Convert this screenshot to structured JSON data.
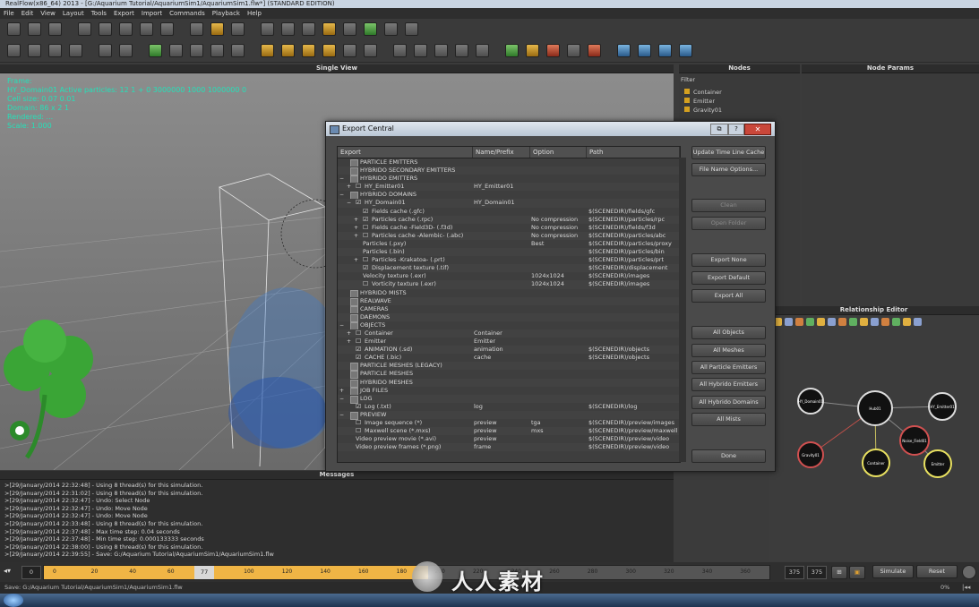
{
  "window": {
    "title": "RealFlow(x86_64) 2013 - [G:/Aquarium Tutorial/AquariumSim1/AquariumSim1.flw*] (STANDARD EDITION)"
  },
  "menu": [
    "File",
    "Edit",
    "View",
    "Layout",
    "Tools",
    "Export",
    "Import",
    "Commands",
    "Playback",
    "Help"
  ],
  "viewport": {
    "title": "Single View",
    "hud": [
      "Frame:",
      "HY_Domain01  Active particles: 12 1 + 0 3000000 1000 1000000 0",
      "Cell size:  0.07  0.01",
      "Domain: 86 x 2 1",
      "Rendered: ...",
      "Scale: 1.000"
    ]
  },
  "nodes": {
    "title": "Nodes",
    "filter": "Filter",
    "items": [
      "Container",
      "Emitter",
      "Gravity01"
    ]
  },
  "params": {
    "title": "Node Params"
  },
  "relationship": {
    "title": "Relationship Editor",
    "nodes": [
      "HY_Domain01",
      "Hub01",
      "HY_Emitter01",
      "Gravity01",
      "Container",
      "Noise_Field01",
      "Emitter"
    ]
  },
  "dialog": {
    "title": "Export Central",
    "columns": [
      "Export",
      "Name/Prefix",
      "Option",
      "Path"
    ],
    "rows": [
      {
        "indent": 0,
        "exp": "",
        "check": "",
        "label": "PARTICLE EMITTERS",
        "name": "",
        "option": "",
        "path": ""
      },
      {
        "indent": 0,
        "exp": "",
        "check": "",
        "label": "HYBRIDO SECONDARY EMITTERS",
        "name": "",
        "option": "",
        "path": ""
      },
      {
        "indent": 0,
        "exp": "−",
        "check": "",
        "label": "HYBRIDO EMITTERS",
        "name": "",
        "option": "",
        "path": ""
      },
      {
        "indent": 1,
        "exp": "+",
        "check": "☐",
        "label": "HY_Emitter01",
        "name": "HY_Emitter01",
        "option": "",
        "path": ""
      },
      {
        "indent": 0,
        "exp": "−",
        "check": "",
        "label": "HYBRIDO DOMAINS",
        "name": "",
        "option": "",
        "path": ""
      },
      {
        "indent": 1,
        "exp": "−",
        "check": "☑",
        "label": "HY_Domain01",
        "name": "HY_Domain01",
        "option": "",
        "path": ""
      },
      {
        "indent": 2,
        "exp": "",
        "check": "☑",
        "label": "Fields cache (.gfc)",
        "name": "",
        "option": "",
        "path": "$(SCENEDIR)/fields/gfc"
      },
      {
        "indent": 2,
        "exp": "+",
        "check": "☑",
        "label": "Particles cache (.rpc)",
        "name": "",
        "option": "No compression",
        "path": "$(SCENEDIR)/particles/rpc"
      },
      {
        "indent": 2,
        "exp": "+",
        "check": "☐",
        "label": "Fields cache -Field3D- (.f3d)",
        "name": "",
        "option": "No compression",
        "path": "$(SCENEDIR)/fields/f3d"
      },
      {
        "indent": 2,
        "exp": "+",
        "check": "☐",
        "label": "Particles cache -Alembic- (.abc)",
        "name": "",
        "option": "No compression",
        "path": "$(SCENEDIR)/particles/abc"
      },
      {
        "indent": 2,
        "exp": "",
        "check": "",
        "label": "Particles (.pxy)",
        "name": "",
        "option": "Best",
        "path": "$(SCENEDIR)/particles/proxy"
      },
      {
        "indent": 2,
        "exp": "",
        "check": "",
        "label": "Particles (.bin)",
        "name": "",
        "option": "",
        "path": "$(SCENEDIR)/particles/bin"
      },
      {
        "indent": 2,
        "exp": "+",
        "check": "☐",
        "label": "Particles -Krakatoa- (.prt)",
        "name": "",
        "option": "",
        "path": "$(SCENEDIR)/particles/prt"
      },
      {
        "indent": 2,
        "exp": "",
        "check": "☑",
        "label": "Displacement texture (.tif)",
        "name": "",
        "option": "",
        "path": "$(SCENEDIR)/displacement"
      },
      {
        "indent": 2,
        "exp": "",
        "check": "",
        "label": "Velocity texture (.exr)",
        "name": "",
        "option": "1024x1024",
        "path": "$(SCENEDIR)/images"
      },
      {
        "indent": 2,
        "exp": "",
        "check": "☐",
        "label": "Vorticity texture (.exr)",
        "name": "",
        "option": "1024x1024",
        "path": "$(SCENEDIR)/images"
      },
      {
        "indent": 0,
        "exp": "",
        "check": "",
        "label": "HYBRIDO MISTS",
        "name": "",
        "option": "",
        "path": ""
      },
      {
        "indent": 0,
        "exp": "",
        "check": "",
        "label": "REALWAVE",
        "name": "",
        "option": "",
        "path": ""
      },
      {
        "indent": 0,
        "exp": "",
        "check": "",
        "label": "CAMERAS",
        "name": "",
        "option": "",
        "path": ""
      },
      {
        "indent": 0,
        "exp": "",
        "check": "",
        "label": "DAEMONS",
        "name": "",
        "option": "",
        "path": ""
      },
      {
        "indent": 0,
        "exp": "−",
        "check": "",
        "label": "OBJECTS",
        "name": "",
        "option": "",
        "path": ""
      },
      {
        "indent": 1,
        "exp": "+",
        "check": "☐",
        "label": "Container",
        "name": "Container",
        "option": "",
        "path": ""
      },
      {
        "indent": 1,
        "exp": "+",
        "check": "☐",
        "label": "Emitter",
        "name": "Emitter",
        "option": "",
        "path": ""
      },
      {
        "indent": 1,
        "exp": "",
        "check": "☑",
        "label": "ANIMATION (.sd)",
        "name": "animation",
        "option": "",
        "path": "$(SCENEDIR)/objects"
      },
      {
        "indent": 1,
        "exp": "",
        "check": "☑",
        "label": "CACHE (.bic)",
        "name": "cache",
        "option": "",
        "path": "$(SCENEDIR)/objects"
      },
      {
        "indent": 0,
        "exp": "",
        "check": "",
        "label": "PARTICLE MESHES (LEGACY)",
        "name": "",
        "option": "",
        "path": ""
      },
      {
        "indent": 0,
        "exp": "",
        "check": "",
        "label": "PARTICLE MESHES",
        "name": "",
        "option": "",
        "path": ""
      },
      {
        "indent": 0,
        "exp": "",
        "check": "",
        "label": "HYBRIDO MESHES",
        "name": "",
        "option": "",
        "path": ""
      },
      {
        "indent": 0,
        "exp": "+",
        "check": "",
        "label": "JOB FILES",
        "name": "",
        "option": "",
        "path": ""
      },
      {
        "indent": 0,
        "exp": "−",
        "check": "",
        "label": "LOG",
        "name": "",
        "option": "",
        "path": ""
      },
      {
        "indent": 1,
        "exp": "",
        "check": "☑",
        "label": "Log (.txt)",
        "name": "log",
        "option": "",
        "path": "$(SCENEDIR)/log"
      },
      {
        "indent": 0,
        "exp": "−",
        "check": "",
        "label": "PREVIEW",
        "name": "",
        "option": "",
        "path": ""
      },
      {
        "indent": 1,
        "exp": "",
        "check": "☐",
        "label": "Image sequence (*)",
        "name": "preview",
        "option": "tga",
        "path": "$(SCENEDIR)/preview/images"
      },
      {
        "indent": 1,
        "exp": "",
        "check": "☐",
        "label": "Maxwell scene (*.mxs)",
        "name": "preview",
        "option": "mxs",
        "path": "$(SCENEDIR)/preview/maxwell"
      },
      {
        "indent": 1,
        "exp": "",
        "check": "",
        "label": "Video preview movie (*.avi)",
        "name": "preview",
        "option": "",
        "path": "$(SCENEDIR)/preview/video"
      },
      {
        "indent": 1,
        "exp": "",
        "check": "",
        "label": "Video preview frames (*.png)",
        "name": "frame",
        "option": "",
        "path": "$(SCENEDIR)/preview/video"
      }
    ],
    "buttons": [
      {
        "label": "Update Time Line Cache",
        "disabled": false,
        "name": "update-timeline-cache-button"
      },
      {
        "label": "File Name Options...",
        "disabled": false,
        "name": "file-name-options-button"
      },
      {
        "label": "Clean",
        "disabled": true,
        "name": "clean-button"
      },
      {
        "label": "Open Folder",
        "disabled": true,
        "name": "open-folder-button"
      },
      {
        "label": "Export None",
        "disabled": false,
        "name": "export-none-button"
      },
      {
        "label": "Export Default",
        "disabled": false,
        "name": "export-default-button"
      },
      {
        "label": "Export All",
        "disabled": false,
        "name": "export-all-button"
      },
      {
        "label": "All Objects",
        "disabled": false,
        "name": "all-objects-button"
      },
      {
        "label": "All Meshes",
        "disabled": false,
        "name": "all-meshes-button"
      },
      {
        "label": "All Particle Emitters",
        "disabled": false,
        "name": "all-particle-emitters-button"
      },
      {
        "label": "All Hybrido Emitters",
        "disabled": false,
        "name": "all-hybrido-emitters-button"
      },
      {
        "label": "All Hybrido Domains",
        "disabled": false,
        "name": "all-hybrido-domains-button"
      },
      {
        "label": "All Mists",
        "disabled": false,
        "name": "all-mists-button"
      },
      {
        "label": "Done",
        "disabled": false,
        "name": "done-button"
      }
    ]
  },
  "messages": {
    "title": "Messages",
    "lines": [
      ">[29/January/2014 22:32:48] - Using 8 thread(s) for this simulation.",
      ">[29/January/2014 22:31:02] - Using 8 thread(s) for this simulation.",
      ">[29/January/2014 22:32:47] - Undo: Select Node",
      ">[29/January/2014 22:32:47] - Undo: Move Node",
      ">[29/January/2014 22:32:47] - Undo: Move Node",
      ">[29/January/2014 22:33:48] - Using 8 thread(s) for this simulation.",
      ">[29/January/2014 22:37:48] - Max time step: 0.04 seconds",
      ">[29/January/2014 22:37:48] - Min time step: 0.000133333 seconds",
      ">[29/January/2014 22:38:00] - Using 8 thread(s) for this simulation.",
      ">[29/January/2014 22:39:55] - Save: G:/Aquarium Tutorial/AquariumSim1/AquariumSim1.flw"
    ]
  },
  "timeline": {
    "start": "0",
    "current": "77",
    "ticks": [
      "0",
      "20",
      "40",
      "60",
      "80",
      "100",
      "120",
      "140",
      "160",
      "180",
      "200",
      "220",
      "240",
      "260",
      "280",
      "300",
      "320",
      "340",
      "360"
    ],
    "end1": "375",
    "end2": "375",
    "simulate": "Simulate",
    "reset": "Reset",
    "progress": 0.53
  },
  "status": {
    "text": "Save: G:/Aquarium Tutorial/AquariumSim1/AquariumSim1.flw",
    "percent": "0%"
  },
  "watermark": "人人素材"
}
